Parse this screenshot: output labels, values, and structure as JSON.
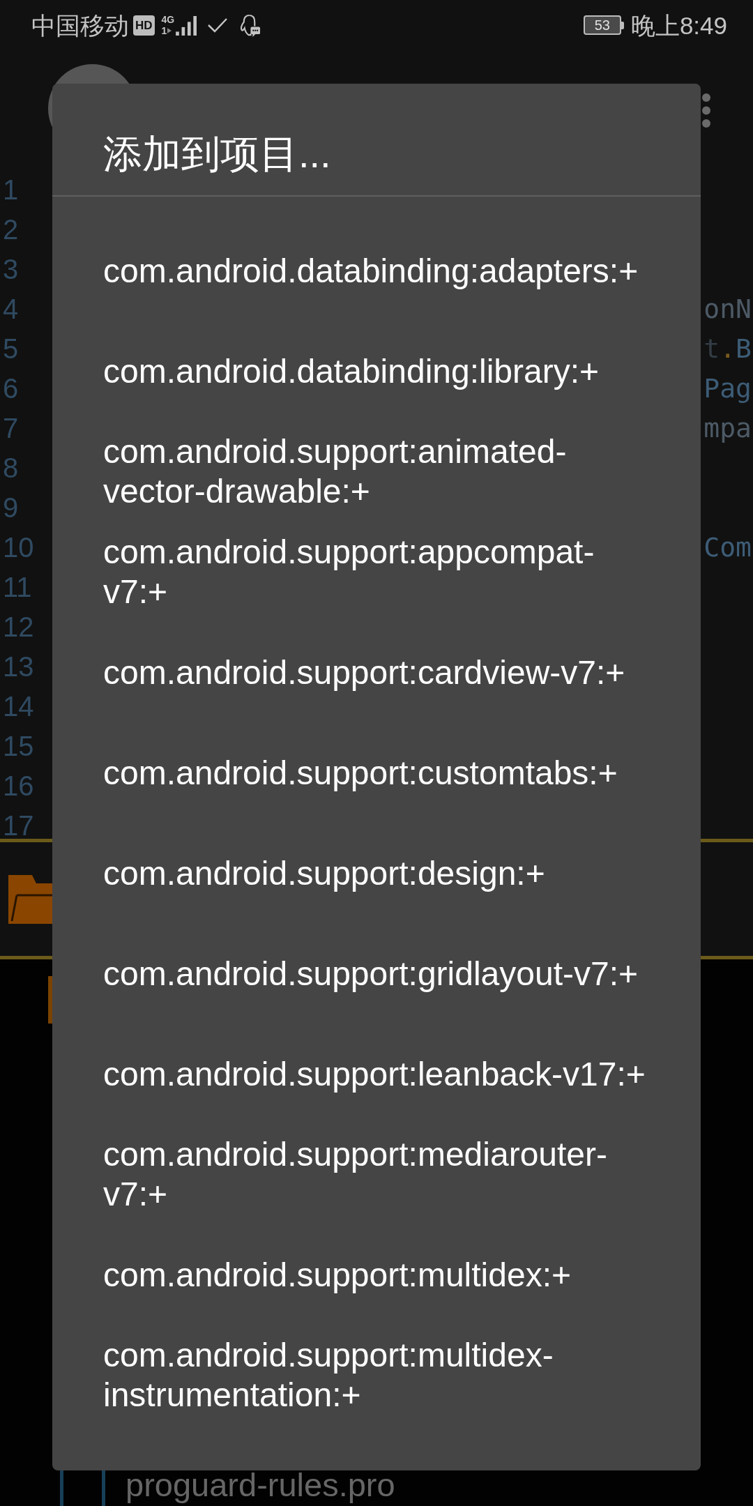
{
  "status_bar": {
    "carrier": "中国移动",
    "hd_badge": "HD",
    "network_type": "4G",
    "sim_slot": "1",
    "battery": "53",
    "time": "晚上8:49"
  },
  "editor": {
    "lines": [
      {
        "number": "1"
      },
      {
        "number": "2"
      },
      {
        "number": "3"
      },
      {
        "number": "4",
        "code": [
          {
            "text": "onN",
            "kind": "ident"
          }
        ]
      },
      {
        "number": "5",
        "code": [
          {
            "text": "t",
            "kind": "plain"
          },
          {
            "text": ".",
            "kind": "punct"
          },
          {
            "text": "B",
            "kind": "type"
          }
        ]
      },
      {
        "number": "6",
        "code": [
          {
            "text": "Pag",
            "kind": "type"
          }
        ]
      },
      {
        "number": "7",
        "code": [
          {
            "text": "mpa",
            "kind": "ident"
          }
        ]
      },
      {
        "number": "8"
      },
      {
        "number": "9"
      },
      {
        "number": "10",
        "code": [
          {
            "text": "Com",
            "kind": "type"
          }
        ]
      },
      {
        "number": "11"
      },
      {
        "number": "12"
      },
      {
        "number": "13"
      },
      {
        "number": "14"
      },
      {
        "number": "15"
      },
      {
        "number": "16"
      },
      {
        "number": "17"
      }
    ]
  },
  "file_tree": {
    "items": [
      {
        "label": "proguard-rules.pro"
      }
    ]
  },
  "dialog": {
    "title": "添加到项目...",
    "items": [
      "com.android.databinding:adapters:+",
      "com.android.databinding:library:+",
      "com.android.support:animated-vector-drawable:+",
      "com.android.support:appcompat-v7:+",
      "com.android.support:cardview-v7:+",
      "com.android.support:customtabs:+",
      "com.android.support:design:+",
      "com.android.support:gridlayout-v7:+",
      "com.android.support:leanback-v17:+",
      "com.android.support:mediarouter-v7:+",
      "com.android.support:multidex:+",
      "com.android.support:multidex-instrumentation:+"
    ]
  }
}
